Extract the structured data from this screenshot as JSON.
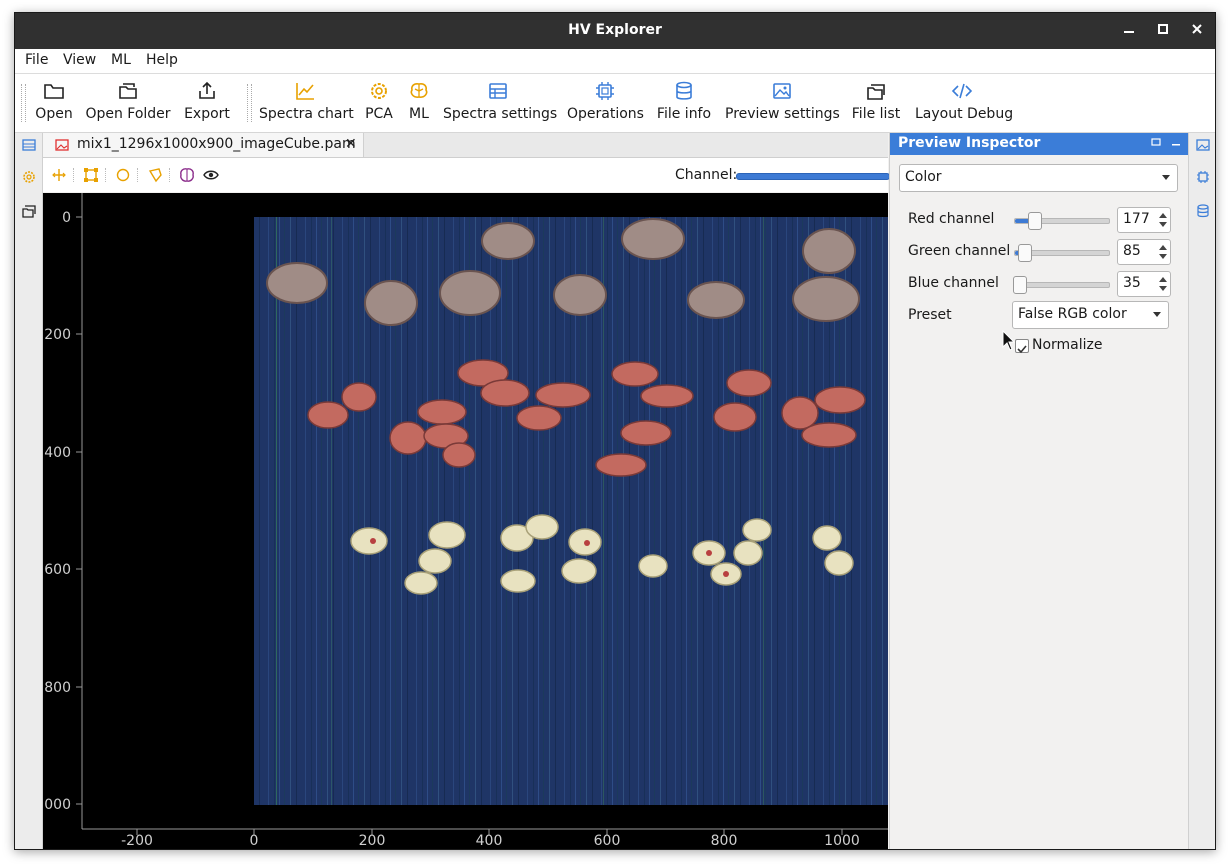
{
  "window": {
    "title": "HV Explorer",
    "controls": {
      "minimize": "–",
      "maximize": "□",
      "close": "✕"
    }
  },
  "menu": [
    "File",
    "View",
    "ML",
    "Help"
  ],
  "toolbar": {
    "items": [
      {
        "label": "Open",
        "icon": "folder-icon"
      },
      {
        "label": "Open Folder",
        "icon": "folder-open-icon"
      },
      {
        "label": "Export",
        "icon": "export-icon"
      },
      {
        "label": "Spectra chart",
        "icon": "line-chart-icon"
      },
      {
        "label": "PCA",
        "icon": "gear-icon"
      },
      {
        "label": "ML",
        "icon": "brain-icon"
      },
      {
        "label": "Spectra settings",
        "icon": "table-icon"
      },
      {
        "label": "Operations",
        "icon": "chip-icon"
      },
      {
        "label": "File info",
        "icon": "database-icon"
      },
      {
        "label": "Preview settings",
        "icon": "image-icon"
      },
      {
        "label": "File list",
        "icon": "files-icon"
      },
      {
        "label": "Layout Debug",
        "icon": "code-icon"
      }
    ]
  },
  "tab": {
    "label": "mix1_1296x1000x900_imageCube.pam",
    "close": "✕",
    "icon": "image-icon"
  },
  "view_tools": {
    "channel_label": "Channel:"
  },
  "plot": {
    "y_ticks": [
      "0",
      "200",
      "400",
      "600",
      "800",
      "1000"
    ],
    "x_ticks": [
      "-200",
      "0",
      "200",
      "400",
      "600",
      "800",
      "1000"
    ],
    "colors": {
      "background": "#000000",
      "image_base": "#1e3566",
      "axis_text": "#d0d0d0"
    }
  },
  "inspector": {
    "title": "Preview Inspector",
    "mode": "Color",
    "channels": [
      {
        "label": "Red channel",
        "value": "177",
        "fraction": 0.2
      },
      {
        "label": "Green channel",
        "value": "85",
        "fraction": 0.1
      },
      {
        "label": "Blue channel",
        "value": "35",
        "fraction": 0.04
      }
    ],
    "preset_label": "Preset",
    "preset_value": "False RGB color",
    "normalize_label": "Normalize",
    "normalize_checked": true
  },
  "accent": "#3b7dd8"
}
